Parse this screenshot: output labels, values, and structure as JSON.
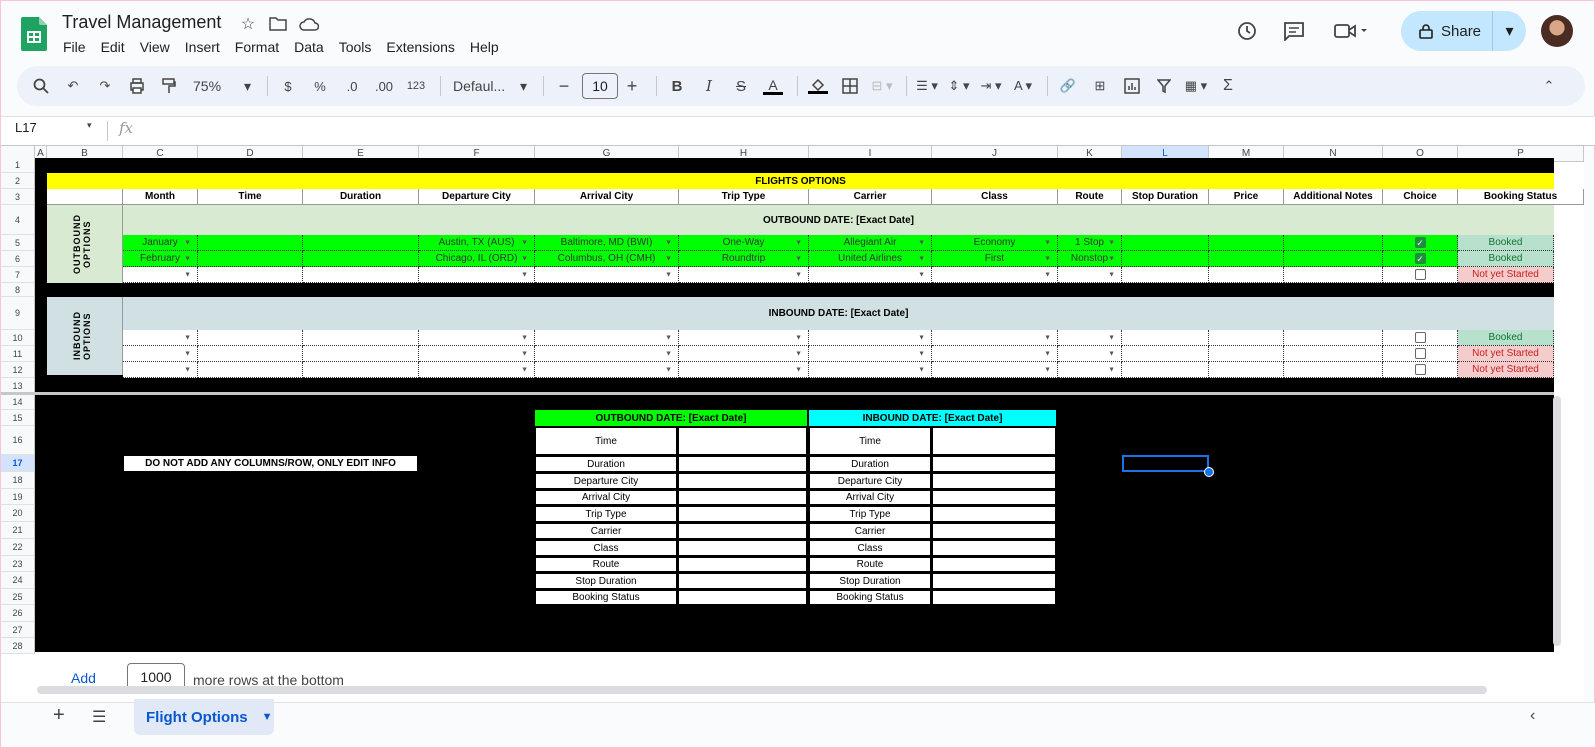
{
  "app": {
    "title": "Travel Management",
    "menu": [
      "File",
      "Edit",
      "View",
      "Insert",
      "Format",
      "Data",
      "Tools",
      "Extensions",
      "Help"
    ],
    "share_label": "Share"
  },
  "toolbar": {
    "zoom": "75%",
    "currency": "$",
    "percent": "%",
    "dec_less": ".0",
    "dec_more": ".00",
    "number_format": "123",
    "font": "Defaul...",
    "font_size": "10"
  },
  "formula": {
    "cell_ref": "L17",
    "fx": "fx"
  },
  "columns": [
    "A",
    "B",
    "C",
    "D",
    "E",
    "F",
    "G",
    "H",
    "I",
    "J",
    "K",
    "L",
    "M",
    "N",
    "O",
    "P"
  ],
  "selected_column": "L",
  "selected_row": "17",
  "rows": [
    "1",
    "2",
    "3",
    "4",
    "5",
    "6",
    "7",
    "8",
    "9",
    "10",
    "11",
    "12",
    "13",
    "14",
    "15",
    "16",
    "17",
    "18",
    "19",
    "20",
    "21",
    "22",
    "23",
    "24",
    "25",
    "26",
    "27",
    "28"
  ],
  "sheet": {
    "banner": "FLIGHTS OPTIONS",
    "headers": [
      "Month",
      "Time",
      "Duration",
      "Departure City",
      "Arrival City",
      "Trip Type",
      "Carrier",
      "Class",
      "Route",
      "Stop Duration",
      "Price",
      "Additional Notes",
      "Choice",
      "Booking Status"
    ],
    "outbound_label": "OUTBOUND OPTIONS",
    "outbound_title": "OUTBOUND DATE: [Exact Date]",
    "inbound_label": "INBOUND OPTIONS",
    "inbound_title": "INBOUND DATE: [Exact Date]",
    "outbound_rows": [
      {
        "month": "January",
        "dep": "Austin, TX (AUS)",
        "arr": "Baltimore, MD (BWI)",
        "trip": "One-Way",
        "carrier": "Allegiant Air",
        "cls": "Economy",
        "route": "1 Stop",
        "checked": true,
        "status": "Booked"
      },
      {
        "month": "February",
        "dep": "Chicago, IL (ORD)",
        "arr": "Columbus, OH (CMH)",
        "trip": "Roundtrip",
        "carrier": "United Airlines",
        "cls": "First",
        "route": "Nonstop",
        "checked": true,
        "status": "Booked"
      },
      {
        "month": "",
        "dep": "",
        "arr": "",
        "trip": "",
        "carrier": "",
        "cls": "",
        "route": "",
        "checked": false,
        "status": "Not yet Started"
      }
    ],
    "inbound_rows": [
      {
        "checked": false,
        "status": "Booked"
      },
      {
        "checked": false,
        "status": "Not yet Started"
      },
      {
        "checked": false,
        "status": "Not yet Started"
      }
    ],
    "notice": "DO NOT ADD ANY COLUMNS/ROW, ONLY EDIT INFO",
    "summary_out_title": "OUTBOUND DATE: [Exact Date]",
    "summary_in_title": "INBOUND DATE: [Exact Date]",
    "summary_fields": [
      "Time",
      "Duration",
      "Departure City",
      "Arrival City",
      "Trip Type",
      "Carrier",
      "Class",
      "Route",
      "Stop Duration",
      "Booking Status"
    ]
  },
  "footer": {
    "add_label": "Add",
    "rows_value": "1000",
    "rows_suffix": "more rows at the bottom",
    "sheet_tab": "Flight Options"
  },
  "colors": {
    "green": "#00ff00",
    "yellow": "#ffff00",
    "cyan": "#00ffff",
    "light_green": "#d9ead3",
    "light_blue": "#d0e0e3",
    "booked": "#b7e1cd",
    "not_started": "#f4cccc"
  }
}
